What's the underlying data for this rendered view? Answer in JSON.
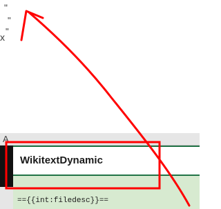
{
  "fragments": {
    "quote_top": "\"",
    "quote_mid": "\"",
    "quote_low": "\"",
    "x_char": "x"
  },
  "sheet": {
    "column_header_label": "A",
    "active_cell_text": "WikitextDynamic",
    "next_row_text": "=={{int:filedesc}}=="
  },
  "annotation": {
    "color": "#ff0000"
  }
}
